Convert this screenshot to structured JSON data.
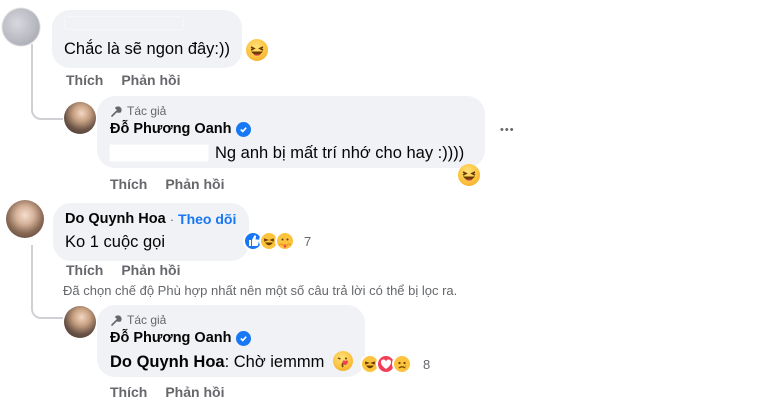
{
  "comments": [
    {
      "text": "Chắc là sẽ ngon đây:))",
      "actions": {
        "like": "Thích",
        "reply": "Phản hồi"
      }
    },
    {
      "author_tag": "Tác giả",
      "name": "Đỗ Phương Oanh",
      "text": "Ng anh bị mất trí nhớ cho hay :))))",
      "actions": {
        "like": "Thích",
        "reply": "Phản hồi"
      },
      "more": "•••"
    },
    {
      "name": "Do Quynh Hoa",
      "separator": "·",
      "follow": "Theo dõi",
      "text": "Ko 1 cuộc gọi",
      "reaction_count": "7",
      "actions": {
        "like": "Thích",
        "reply": "Phản hồi"
      }
    },
    {
      "author_tag": "Tác giả",
      "name": "Đỗ Phương Oanh",
      "mention": "Do Quynh Hoa",
      "text": ": Chờ iemmm",
      "reaction_count": "8",
      "actions": {
        "like": "Thích",
        "reply": "Phản hồi"
      }
    }
  ],
  "filter_notice": "Đã chọn chế độ Phù hợp nhất nên một số câu trả lời có thể bị lọc ra.",
  "colors": {
    "link": "#1877f2",
    "muted": "#65676b",
    "bubble": "#f0f2f5",
    "like": "#1877f2",
    "love": "#f33e58",
    "emoji": "#fcc33f"
  }
}
